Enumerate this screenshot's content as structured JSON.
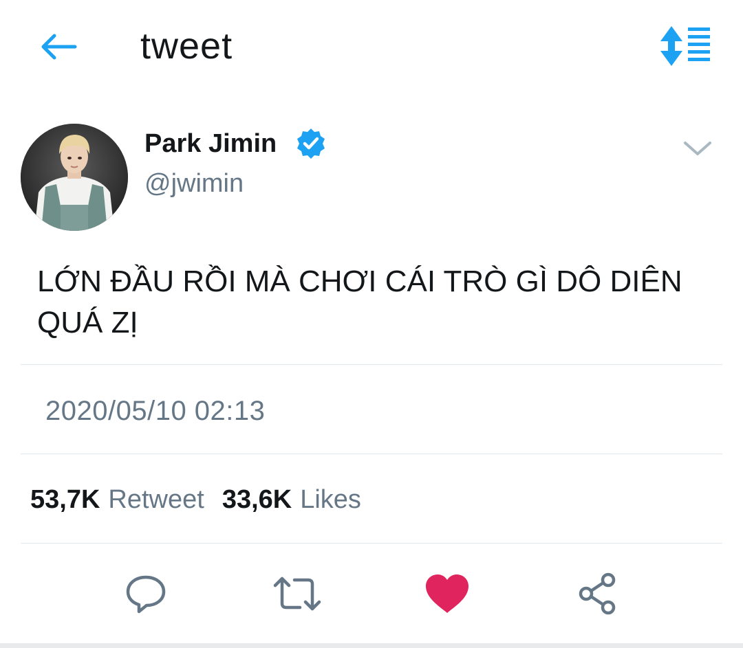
{
  "header": {
    "title": "tweet",
    "back_icon": "arrow-left-icon",
    "sort_icon": "sort-list-icon"
  },
  "author": {
    "name": "Park Jimin",
    "handle": "@jwimin",
    "verified": true,
    "menu_icon": "chevron-down-icon"
  },
  "tweet": {
    "text_line1": "LỚN ĐẦU RỒI MÀ CHƠI CÁI TRÒ GÌ DÔ DIÊN",
    "text_line2": "QUÁ ZỊ",
    "timestamp": "2020/05/10 02:13"
  },
  "stats": {
    "retweets_count": "53,7K",
    "retweets_label": "Retweet",
    "likes_count": "33,6K",
    "likes_label": "Likes"
  },
  "actions": [
    {
      "icon": "reply-icon"
    },
    {
      "icon": "retweet-icon"
    },
    {
      "icon": "like-heart-icon",
      "active": true
    },
    {
      "icon": "share-icon"
    }
  ],
  "colors": {
    "accent": "#1da1f2",
    "text_primary": "#14171a",
    "text_secondary": "#657786",
    "like": "#e0245e",
    "divider": "#e1e8ed"
  }
}
